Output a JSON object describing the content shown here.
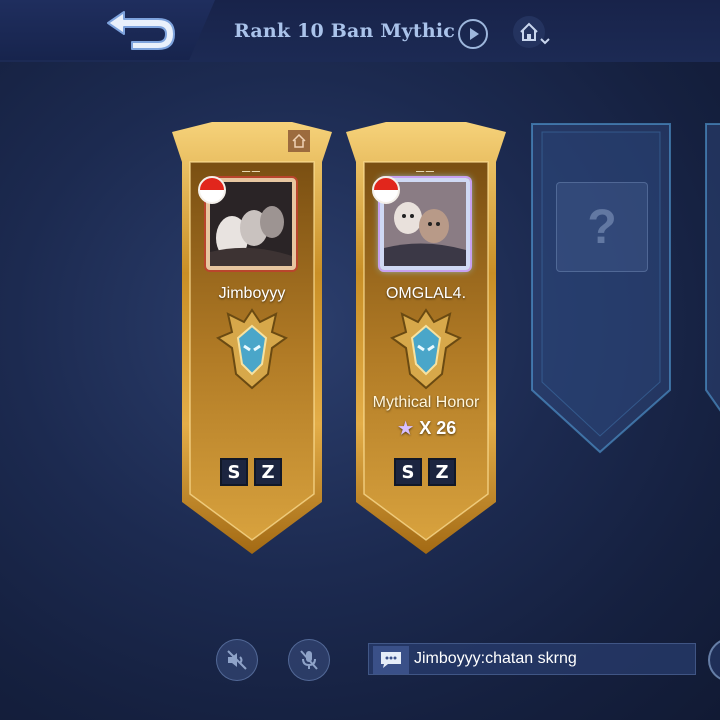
{
  "header": {
    "title": "Rank 10 Ban Mythic",
    "back_icon": "back-arrow-icon",
    "play_icon": "play-icon",
    "home_icon": "home-dropdown-icon"
  },
  "players": [
    {
      "dash": "__",
      "name": "Jimboyyy",
      "flag": "indonesia-flag-icon",
      "badges": [
        "S",
        "Z"
      ]
    },
    {
      "dash": "__",
      "name": "OMGLAL4.",
      "flag": "indonesia-flag-icon",
      "rank": "Mythical Honor",
      "stars": "X 26",
      "badges": [
        "S",
        "Z"
      ]
    }
  ],
  "empty_slot": {
    "placeholder": "?"
  },
  "chat": {
    "message": "Jimboyyy:chatan skrng"
  },
  "colors": {
    "gold": "#d9a53a",
    "title": "#aac3ea",
    "flag_red": "#e1261c"
  }
}
